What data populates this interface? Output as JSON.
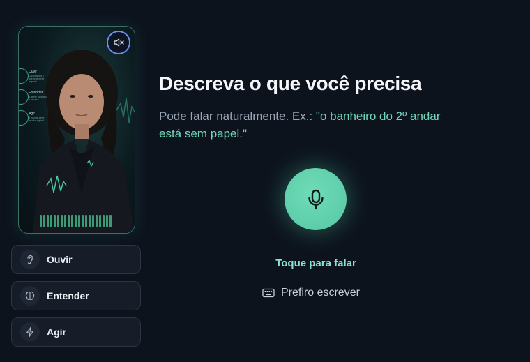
{
  "avatar": {
    "mute_icon": "speaker-muted-icon",
    "hud": [
      {
        "title": "Ouvir",
        "subtitle": "Capturamos o que realmente importa"
      },
      {
        "title": "Entender",
        "subtitle": "A gente classifica e prioriza"
      },
      {
        "title": "Agir",
        "subtitle": "A equipe certa resolve rápido"
      }
    ]
  },
  "steps": [
    {
      "label": "Ouvir",
      "icon": "ear-icon"
    },
    {
      "label": "Entender",
      "icon": "brain-icon"
    },
    {
      "label": "Agir",
      "icon": "lightning-icon"
    }
  ],
  "main": {
    "title": "Descreva o que você precisa",
    "subtitle_prefix": "Pode falar naturalmente. Ex.: ",
    "subtitle_example": "\"o banheiro do 2º andar está sem papel.\"",
    "mic_caption": "Toque para falar",
    "write_label": "Prefiro escrever"
  },
  "colors": {
    "accent": "#5fd0ad",
    "background": "#0d131d"
  }
}
